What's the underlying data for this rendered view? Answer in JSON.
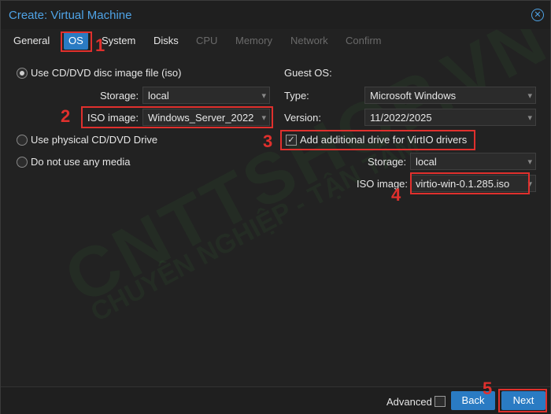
{
  "window": {
    "title": "Create: Virtual Machine"
  },
  "tabs": [
    {
      "label": "General",
      "state": "normal"
    },
    {
      "label": "OS",
      "state": "active"
    },
    {
      "label": "System",
      "state": "normal"
    },
    {
      "label": "Disks",
      "state": "normal"
    },
    {
      "label": "CPU",
      "state": "disabled"
    },
    {
      "label": "Memory",
      "state": "disabled"
    },
    {
      "label": "Network",
      "state": "disabled"
    },
    {
      "label": "Confirm",
      "state": "disabled"
    }
  ],
  "media": {
    "opt_iso": "Use CD/DVD disc image file (iso)",
    "storage_label": "Storage:",
    "storage_value": "local",
    "iso_label": "ISO image:",
    "iso_value": "Windows_Server_2022",
    "opt_physical": "Use physical CD/DVD Drive",
    "opt_none": "Do not use any media"
  },
  "guest": {
    "heading": "Guest OS:",
    "type_label": "Type:",
    "type_value": "Microsoft Windows",
    "version_label": "Version:",
    "version_value": "11/2022/2025",
    "virtio_label": "Add additional drive for VirtIO drivers",
    "storage_label": "Storage:",
    "storage_value": "local",
    "iso_label": "ISO image:",
    "iso_value": "virtio-win-0.1.285.iso"
  },
  "annotations": [
    "1",
    "2",
    "3",
    "4",
    "5"
  ],
  "footer": {
    "advanced": "Advanced",
    "back": "Back",
    "next": "Next"
  },
  "watermark": {
    "main": "CNTTSHOP.VN",
    "sub": "CHUYÊN NGHIỆP - TẬN TÂM"
  },
  "colors": {
    "accent": "#2a7bc3",
    "title": "#4fa3e6",
    "annotation": "#e0302d"
  }
}
